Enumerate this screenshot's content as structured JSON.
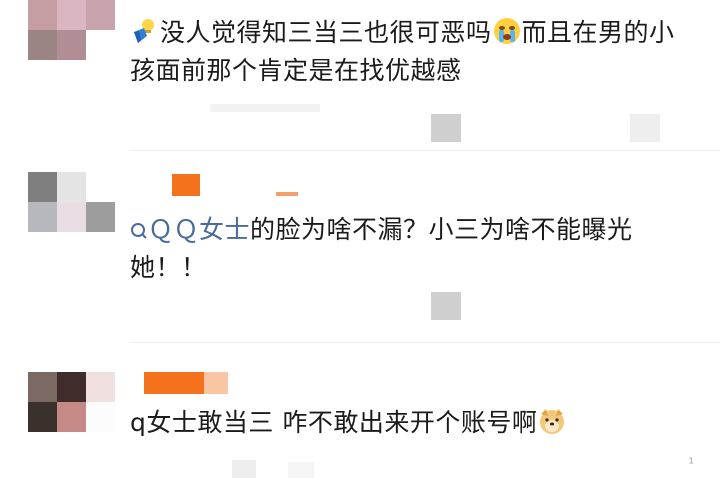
{
  "comments": [
    {
      "text_main": "没人觉得知三当三也很可恶吗",
      "text_after": "而且在男的小孩面前那个肯定是在找优越感",
      "emoji_lead": "thumbs-down-lightbulb-icon",
      "emoji_mid": "crying-face-icon"
    },
    {
      "mention": "ＱＱ女士",
      "text_main": "的脸为啥不漏？小三为啥不能曝光她！！",
      "mention_icon": "search-icon"
    },
    {
      "text_main": "q女士敢当三 咋不敢出来开个账号啊",
      "emoji_end": "doge-face-icon"
    }
  ],
  "colors": {
    "mention": "#4a6a9c",
    "name_orange": "#f5721c",
    "text": "#1b1b1b",
    "divider": "#ececec"
  }
}
